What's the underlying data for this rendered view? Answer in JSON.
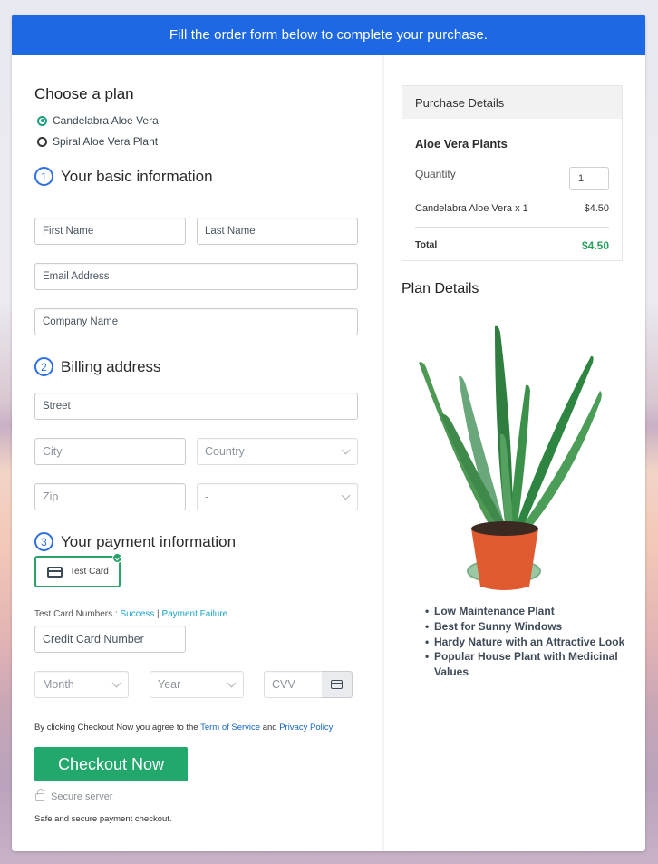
{
  "banner": {
    "text": "Fill the order form below to complete your purchase."
  },
  "plan": {
    "title": "Choose a plan",
    "options": [
      {
        "label": "Candelabra Aloe Vera",
        "selected": true
      },
      {
        "label": "Spiral Aloe Vera Plant",
        "selected": false
      }
    ]
  },
  "basic_info": {
    "step": "1",
    "title": "Your basic information",
    "first_name_placeholder": "First Name",
    "last_name_placeholder": "Last Name",
    "email_placeholder": "Email Address",
    "company_placeholder": "Company Name"
  },
  "billing": {
    "step": "2",
    "title": "Billing address",
    "street_placeholder": "Street",
    "city_placeholder": "City",
    "country_select": "Country",
    "zip_placeholder": "Zip",
    "state_select": "-"
  },
  "payment": {
    "step": "3",
    "title": "Your payment information",
    "method_label": "Test Card",
    "test_numbers_label": "Test Card Numbers : ",
    "success_link": "Success",
    "separator": " | ",
    "failure_link": "Payment Failure",
    "card_number_placeholder": "Credit Card Number",
    "month_select": "Month",
    "year_select": "Year",
    "cvv_placeholder": "CVV",
    "agree_prefix": "By clicking Checkout Now you agree to the ",
    "terms_link": "Term of Service",
    "agree_and": " and ",
    "privacy_link": "Privacy Policy",
    "checkout_button": "Checkout Now",
    "secure_server": "Secure server",
    "safe_note": "Safe and secure payment checkout."
  },
  "purchase": {
    "header": "Purchase Details",
    "product_name": "Aloe Vera Plants",
    "quantity_label": "Quantity",
    "quantity_value": "1",
    "line_item_label": "Candelabra Aloe Vera x 1",
    "line_item_price": "$4.50",
    "total_label": "Total",
    "total_value": "$4.50"
  },
  "plan_details": {
    "title": "Plan Details",
    "image_alt": "Aloe vera plant in orange pot",
    "features": [
      "Low Maintenance Plant",
      "Best for Sunny Windows",
      "Hardy Nature with an Attractive Look",
      "Popular House Plant with Medicinal Values"
    ]
  },
  "colors": {
    "banner_blue": "#1e69e3",
    "checkout_green": "#22a86c",
    "total_green": "#26a35a",
    "link_teal": "#1aa3c7"
  }
}
